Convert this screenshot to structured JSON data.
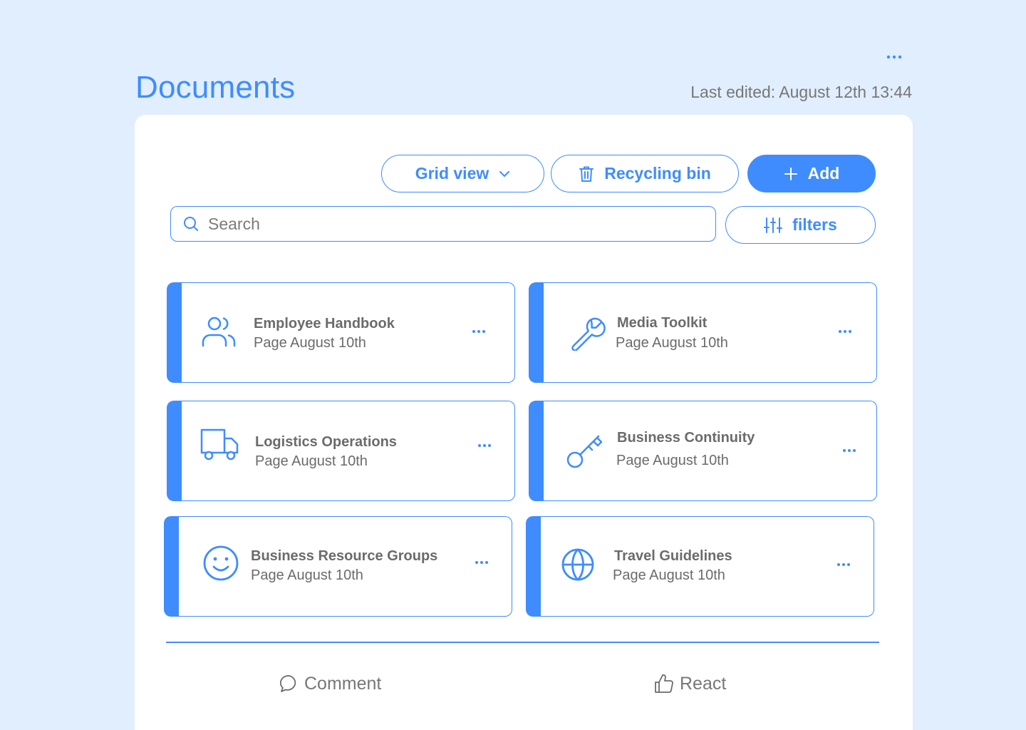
{
  "header": {
    "title": "Documents",
    "last_edited": "Last edited: August 12th 13:44",
    "more_icon": "more-horizontal-icon"
  },
  "toolbar": {
    "grid_view_label": "Grid view",
    "recycling_bin_label": "Recycling bin",
    "add_label": "Add",
    "filters_label": "filters"
  },
  "search": {
    "placeholder": "Search"
  },
  "documents": [
    {
      "name": "Employee Handbook",
      "subtitle": "Page August 10th",
      "icon": "users-icon"
    },
    {
      "name": "Media Toolkit",
      "subtitle": "Page August 10th",
      "icon": "wrench-icon"
    },
    {
      "name": "Logistics Operations",
      "subtitle": "Page August 10th",
      "icon": "truck-icon"
    },
    {
      "name": "Business Continuity",
      "subtitle": "Page August 10th",
      "icon": "key-icon"
    },
    {
      "name": "Business Resource Groups",
      "subtitle": "Page August 10th",
      "icon": "smile-icon"
    },
    {
      "name": "Travel Guidelines",
      "subtitle": "Page August 10th",
      "icon": "globe-icon"
    }
  ],
  "footer": {
    "comment_label": "Comment",
    "react_label": "React"
  },
  "colors": {
    "accent": "#3f8cff",
    "background": "#e1eefe",
    "text_muted": "#6b6b6b"
  }
}
